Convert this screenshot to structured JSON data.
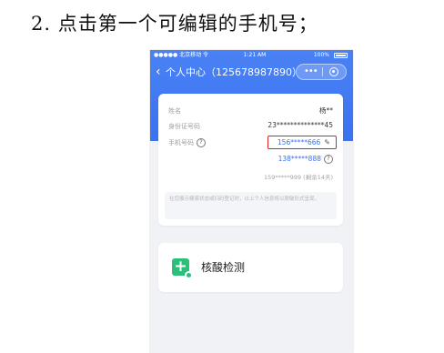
{
  "instruction": "2. 点击第一个可编辑的手机号；",
  "statusbar": {
    "carrier": "●●●●● 北京移动 令",
    "time": "1:21 AM",
    "battery": "100%"
  },
  "navbar": {
    "back_icon": "‹",
    "title": "个人中心（125678987890）",
    "more_icon": "•••",
    "close_icon": "close-icon"
  },
  "info": {
    "name_label": "姓名",
    "name_value": "杨**",
    "id_label": "身份证号码",
    "id_value": "23**************45",
    "phone_label": "手机号码",
    "phone_help": "?",
    "phones": [
      {
        "number": "156*****666",
        "editable": true
      },
      {
        "number": "138*****888",
        "help": "?"
      },
      {
        "number": "159*****999",
        "note": "(剩余14天)"
      }
    ],
    "edit_icon": "✎",
    "notice": "在您展示健康状态或扫码登记时，以上个人信息将以脱敏形式呈现。"
  },
  "nucleic": {
    "icon": "+",
    "label": "核酸检测"
  },
  "colors": {
    "header_blue": "#3a72f0",
    "highlight_red": "#d9251c",
    "icon_green": "#2cbf7a",
    "link_blue": "#3a72f0"
  }
}
